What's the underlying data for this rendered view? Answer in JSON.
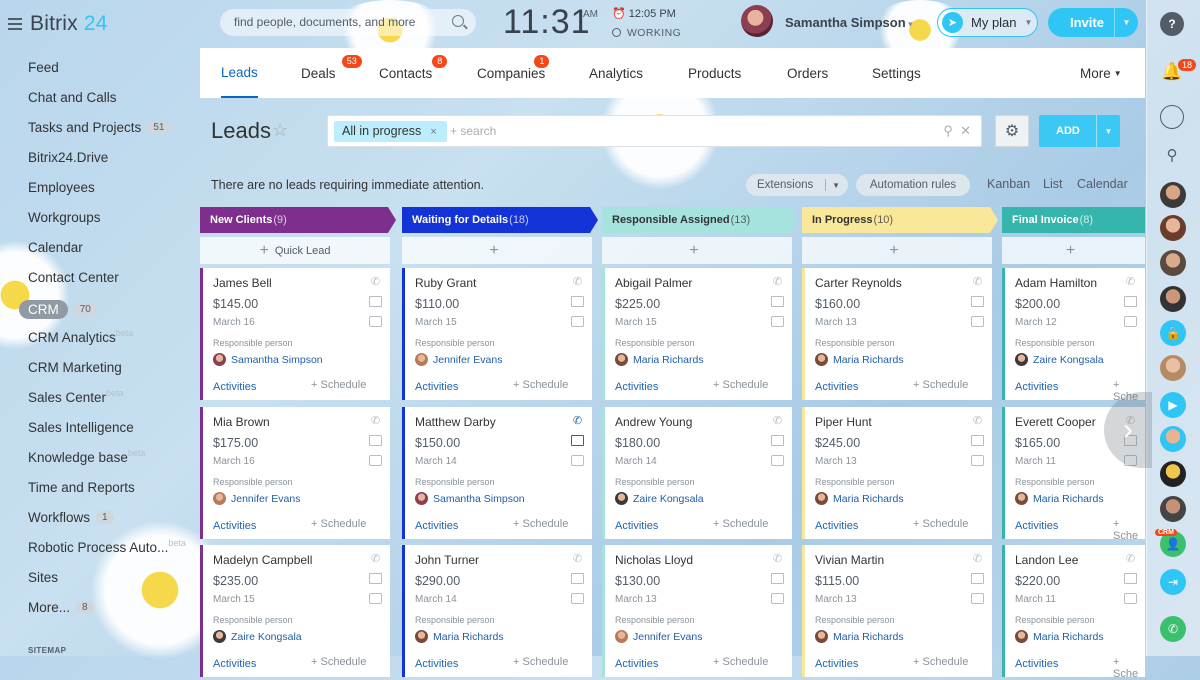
{
  "app": {
    "logo_main": "Bitrix",
    "logo_num": "24"
  },
  "menu": [
    {
      "label": "Feed"
    },
    {
      "label": "Chat and Calls"
    },
    {
      "label": "Tasks and Projects",
      "counter": "51"
    },
    {
      "label": "Bitrix24.Drive"
    },
    {
      "label": "Employees"
    },
    {
      "label": "Workgroups"
    },
    {
      "label": "Calendar"
    },
    {
      "label": "Contact Center"
    },
    {
      "label": "CRM",
      "counter": "70"
    },
    {
      "label": "CRM Analytics",
      "beta": "beta"
    },
    {
      "label": "CRM Marketing"
    },
    {
      "label": "Sales Center",
      "beta": "beta"
    },
    {
      "label": "Sales Intelligence"
    },
    {
      "label": "Knowledge base",
      "beta": "beta"
    },
    {
      "label": "Time and Reports"
    },
    {
      "label": "Workflows",
      "counter": "1"
    },
    {
      "label": "Robotic Process Auto...",
      "beta": "beta"
    },
    {
      "label": "Sites"
    },
    {
      "label": "More...",
      "counter": "8"
    }
  ],
  "sitemap": "SITEMAP",
  "header": {
    "search_placeholder": "find people, documents, and more",
    "clock": "11:31",
    "ampm": "AM",
    "alarm_time": "12:05 PM",
    "status": "WORKING",
    "user_name": "Samantha Simpson",
    "plan_label": "My plan",
    "invite_label": "Invite"
  },
  "rightbar": {
    "help": "?",
    "notifications": "18",
    "crm_tag": "CRM"
  },
  "tabs": [
    {
      "label": "Leads",
      "active": true
    },
    {
      "label": "Deals",
      "badge": "53"
    },
    {
      "label": "Contacts",
      "badge": "8"
    },
    {
      "label": "Companies",
      "badge": "1"
    },
    {
      "label": "Analytics"
    },
    {
      "label": "Products"
    },
    {
      "label": "Orders"
    },
    {
      "label": "Settings"
    }
  ],
  "tabs_more": "More",
  "toolbar": {
    "title": "Leads",
    "filter_chip": "All in progress",
    "filter_placeholder": "+ search",
    "add_label": "ADD",
    "notice": "There are no leads requiring immediate attention.",
    "extensions": "Extensions",
    "automation": "Automation rules",
    "views": [
      "Kanban",
      "List",
      "Calendar"
    ]
  },
  "columns": [
    {
      "title": "New Clients",
      "count": "(9)",
      "color": "#7e2f8e",
      "text": "#ffffff",
      "add": "Quick Lead",
      "cards": [
        {
          "name": "James Bell",
          "price": "$145.00",
          "date": "March 16",
          "resp": "Responsible person",
          "person": "Samantha Simpson",
          "act": "Activities",
          "sched": "+ Schedule"
        },
        {
          "name": "Mia Brown",
          "price": "$175.00",
          "date": "March 16",
          "resp": "Responsible person",
          "person": "Jennifer Evans",
          "act": "Activities",
          "sched": "+ Schedule"
        },
        {
          "name": "Madelyn Campbell",
          "price": "$235.00",
          "date": "March 15",
          "resp": "Responsible person",
          "person": "Zaire Kongsala",
          "act": "Activities",
          "sched": "+ Schedule"
        }
      ]
    },
    {
      "title": "Waiting for Details",
      "count": "(18)",
      "color": "#1433d6",
      "text": "#ffffff",
      "add": "",
      "cards": [
        {
          "name": "Ruby Grant",
          "price": "$110.00",
          "date": "March 15",
          "resp": "Responsible person",
          "person": "Jennifer Evans",
          "act": "Activities",
          "sched": "+ Schedule"
        },
        {
          "name": "Matthew Darby",
          "price": "$150.00",
          "date": "March 14",
          "resp": "Responsible person",
          "person": "Samantha Simpson",
          "act": "Activities",
          "sched": "+ Schedule"
        },
        {
          "name": "John Turner",
          "price": "$290.00",
          "date": "March 14",
          "resp": "Responsible person",
          "person": "Maria Richards",
          "act": "Activities",
          "sched": "+ Schedule"
        }
      ]
    },
    {
      "title": "Responsible Assigned",
      "count": "(13)",
      "color": "#a6e3df",
      "text": "#333333",
      "add": "",
      "cards": [
        {
          "name": "Abigail Palmer",
          "price": "$225.00",
          "date": "March 15",
          "resp": "Responsible person",
          "person": "Maria Richards",
          "act": "Activities",
          "sched": "+ Schedule"
        },
        {
          "name": "Andrew Young",
          "price": "$180.00",
          "date": "March 14",
          "resp": "Responsible person",
          "person": "Zaire Kongsala",
          "act": "Activities",
          "sched": "+ Schedule"
        },
        {
          "name": "Nicholas Lloyd",
          "price": "$130.00",
          "date": "March 13",
          "resp": "Responsible person",
          "person": "Jennifer Evans",
          "act": "Activities",
          "sched": "+ Schedule"
        }
      ]
    },
    {
      "title": "In Progress",
      "count": "(10)",
      "color": "#f9e79a",
      "text": "#333333",
      "add": "",
      "cards": [
        {
          "name": "Carter Reynolds",
          "price": "$160.00",
          "date": "March 13",
          "resp": "Responsible person",
          "person": "Maria Richards",
          "act": "Activities",
          "sched": "+ Schedule"
        },
        {
          "name": "Piper Hunt",
          "price": "$245.00",
          "date": "March 13",
          "resp": "Responsible person",
          "person": "Maria Richards",
          "act": "Activities",
          "sched": "+ Schedule"
        },
        {
          "name": "Vivian Martin",
          "price": "$115.00",
          "date": "March 13",
          "resp": "Responsible person",
          "person": "Maria Richards",
          "act": "Activities",
          "sched": "+ Schedule"
        }
      ]
    },
    {
      "title": "Final Invoice",
      "count": "(8)",
      "color": "#35b5ac",
      "text": "#ffffff",
      "add": "",
      "cards": [
        {
          "name": "Adam Hamilton",
          "price": "$200.00",
          "date": "March 12",
          "resp": "Responsible person",
          "person": "Zaire Kongsala",
          "act": "Activities",
          "sched": "+ Sche"
        },
        {
          "name": "Everett Cooper",
          "price": "$165.00",
          "date": "March 11",
          "resp": "Responsible person",
          "person": "Maria Richards",
          "act": "Activities",
          "sched": "+ Sche"
        },
        {
          "name": "Landon Lee",
          "price": "$220.00",
          "date": "March 11",
          "resp": "Responsible person",
          "person": "Maria Richards",
          "act": "Activities",
          "sched": "+ Sche"
        }
      ]
    }
  ]
}
